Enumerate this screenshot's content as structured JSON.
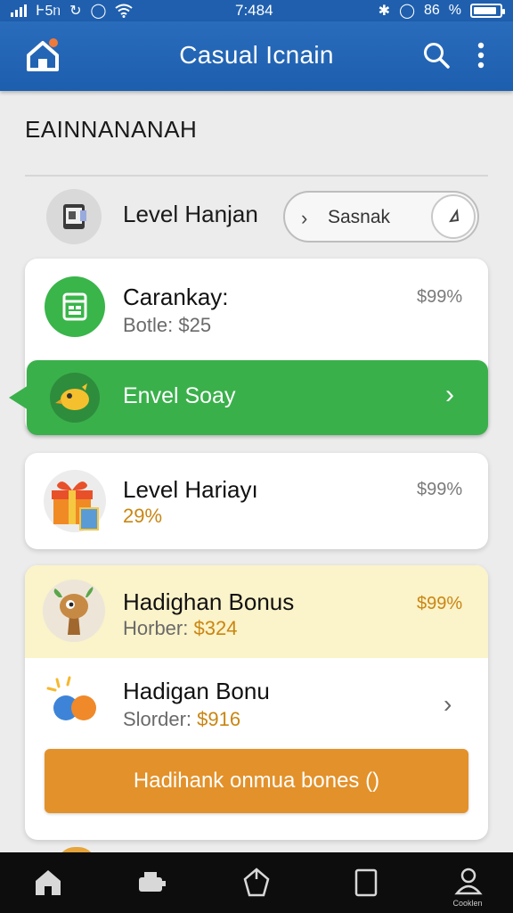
{
  "status_bar": {
    "carrier": "Ͱ5ᥒ",
    "time": "7:484",
    "battery": "86",
    "battery_unit": "%",
    "battery_level": 0.9
  },
  "app_bar": {
    "title": "Casual Icnain"
  },
  "section": {
    "title": "EAINNANANAH"
  },
  "level_row": {
    "label": "Level Hanjan",
    "search_pill": "Sasnak",
    "chevron": "›"
  },
  "card_a": {
    "title": "Carankay:",
    "subtitle": "Botle: $25",
    "percent": "$99%"
  },
  "green_banner": {
    "label": "Envel Soay",
    "chevron": "›"
  },
  "card_b": {
    "title": "Level Hariayı",
    "subtitle": "29%",
    "percent": "$99%"
  },
  "card_c": {
    "bonus_title": "Hadighan Bonus",
    "bonus_sub_label": "Horber:",
    "bonus_sub_value": "$324",
    "bonus_percent": "$99%",
    "item_title": "Hadigan Bonu",
    "item_sub_label": "Slorder:",
    "item_sub_value": "$916",
    "chevron": "›",
    "button_label": "Hadihank onmua bones ()"
  },
  "bottom_nav": {
    "items": [
      "home-icon",
      "chef-icon",
      "tag-icon",
      "tablet-icon",
      "profile-icon"
    ],
    "last_label": "Cooklen"
  },
  "colors": {
    "app_bar": "#1f5fae",
    "green": "#3ab04b",
    "orange": "#e3912a",
    "highlight": "#fbf3c9",
    "gold_text": "#c98612"
  }
}
